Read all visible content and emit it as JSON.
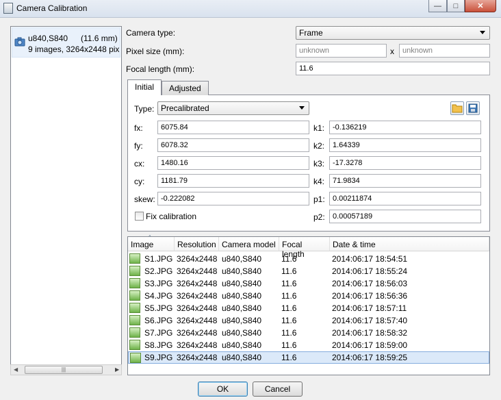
{
  "window": {
    "title": "Camera Calibration",
    "icon": "film-icon",
    "controls": [
      "minimize",
      "maximize",
      "close"
    ]
  },
  "camera_list": {
    "items": [
      {
        "name": "u840,S840",
        "focal": "(11.6 mm)",
        "details": "9 images, 3264x2448 pix",
        "icon": "camera-icon"
      }
    ],
    "scrollbar_grip": "|||"
  },
  "form": {
    "camera_type_label": "Camera type:",
    "camera_type_value": "Frame",
    "pixel_size_label": "Pixel size (mm):",
    "pixel_size_x_placeholder": "unknown",
    "pixel_size_sep": "x",
    "pixel_size_y_placeholder": "unknown",
    "focal_length_label": "Focal length (mm):",
    "focal_length_value": "11.6"
  },
  "tabs": [
    {
      "label": "Initial",
      "selected": true
    },
    {
      "label": "Adjusted",
      "selected": false
    }
  ],
  "initial": {
    "type_label": "Type:",
    "type_value": "Precalibrated",
    "params_left": [
      {
        "label": "fx:",
        "value": "6075.84"
      },
      {
        "label": "fy:",
        "value": "6078.32"
      },
      {
        "label": "cx:",
        "value": "1480.16"
      },
      {
        "label": "cy:",
        "value": "1181.79"
      },
      {
        "label": "skew:",
        "value": "-0.222082"
      }
    ],
    "params_right": [
      {
        "label": "k1:",
        "value": "-0.136219"
      },
      {
        "label": "k2:",
        "value": "1.64339"
      },
      {
        "label": "k3:",
        "value": "-17.3278"
      },
      {
        "label": "k4:",
        "value": "71.9834"
      },
      {
        "label": "p1:",
        "value": "0.00211874"
      },
      {
        "label": "p2:",
        "value": "0.00057189"
      }
    ],
    "fix_calibration_label": "Fix calibration",
    "fix_calibration_checked": false
  },
  "images_table": {
    "columns": [
      "Image",
      "Resolution",
      "Camera model",
      "Focal length",
      "Date & time"
    ],
    "sort_indicator": "^",
    "rows": [
      [
        "S1.JPG",
        "3264x2448",
        "u840,S840",
        "11.6",
        "2014:06:17 18:54:51"
      ],
      [
        "S2.JPG",
        "3264x2448",
        "u840,S840",
        "11.6",
        "2014:06:17 18:55:24"
      ],
      [
        "S3.JPG",
        "3264x2448",
        "u840,S840",
        "11.6",
        "2014:06:17 18:56:03"
      ],
      [
        "S4.JPG",
        "3264x2448",
        "u840,S840",
        "11.6",
        "2014:06:17 18:56:36"
      ],
      [
        "S5.JPG",
        "3264x2448",
        "u840,S840",
        "11.6",
        "2014:06:17 18:57:11"
      ],
      [
        "S6.JPG",
        "3264x2448",
        "u840,S840",
        "11.6",
        "2014:06:17 18:57:40"
      ],
      [
        "S7.JPG",
        "3264x2448",
        "u840,S840",
        "11.6",
        "2014:06:17 18:58:32"
      ],
      [
        "S8.JPG",
        "3264x2448",
        "u840,S840",
        "11.6",
        "2014:06:17 18:59:00"
      ],
      [
        "S9.JPG",
        "3264x2448",
        "u840,S840",
        "11.6",
        "2014:06:17 18:59:25"
      ]
    ],
    "selected_row": 8
  },
  "buttons": {
    "ok": "OK",
    "cancel": "Cancel"
  },
  "colors": {
    "selection": "#dbe9f9",
    "selection_border": "#84acdd",
    "title_bg": "#dde6f1"
  }
}
